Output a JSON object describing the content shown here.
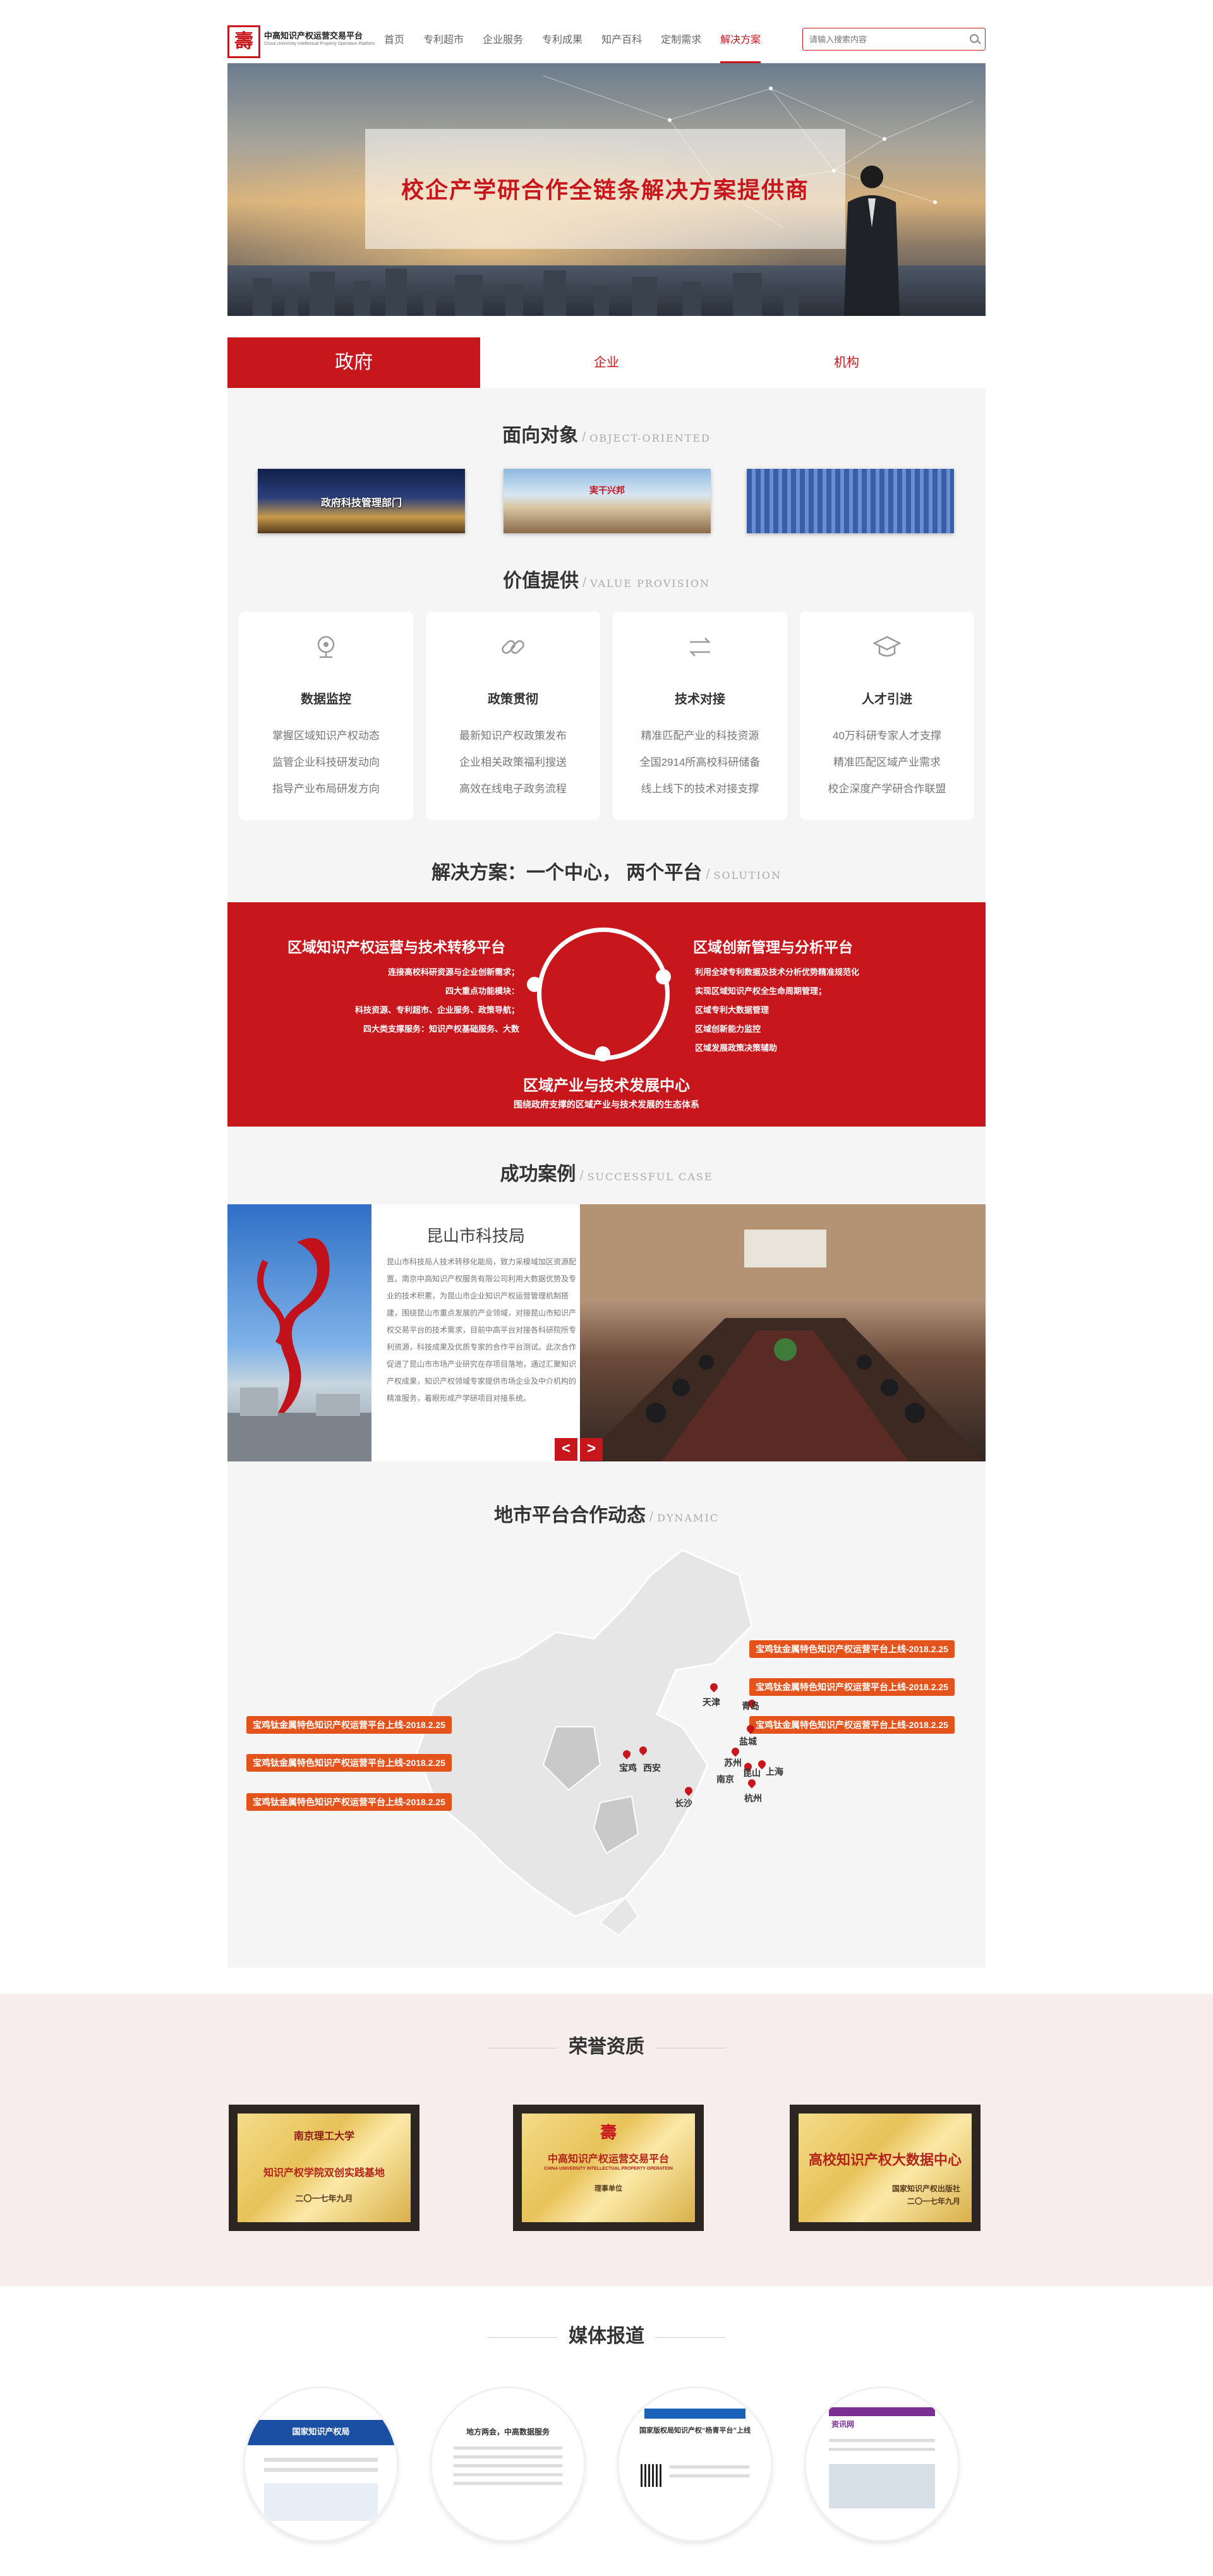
{
  "header": {
    "logo_glyph": "壽",
    "logo_text": "中高知识产权运营交易平台",
    "logo_subtext": "China University Intellectual Property Operation Platform",
    "nav": [
      {
        "label": "首页",
        "active": false
      },
      {
        "label": "专利超市",
        "active": false
      },
      {
        "label": "企业服务",
        "active": false
      },
      {
        "label": "专利成果",
        "active": false
      },
      {
        "label": "知产百科",
        "active": false
      },
      {
        "label": "定制需求",
        "active": false
      },
      {
        "label": "解决方案",
        "active": true
      }
    ],
    "search_placeholder": "请输入搜索内容"
  },
  "hero": {
    "title": "校企产学研合作全链条解决方案提供商"
  },
  "tabs": [
    {
      "label": "政府",
      "active": true
    },
    {
      "label": "企业",
      "active": false
    },
    {
      "label": "机构",
      "active": false
    }
  ],
  "object_section": {
    "title": "面向对象",
    "en": "Object-oriented",
    "targets": [
      {
        "label": "政府科技管理部门"
      },
      {
        "label": "実干兴邦"
      },
      {
        "label": ""
      }
    ]
  },
  "value_section": {
    "title": "价值提供",
    "en": "Value provision",
    "cards": [
      {
        "icon": "monitor-icon",
        "title": "数据监控",
        "lines": [
          "掌握区域知识产权动态",
          "监管企业科技研发动向",
          "指导产业布局研发方向"
        ]
      },
      {
        "icon": "link-icon",
        "title": "政策贯彻",
        "lines": [
          "最新知识产权政策发布",
          "企业相关政策福利搜送",
          "高效在线电子政务流程"
        ]
      },
      {
        "icon": "exchange-icon",
        "title": "技术对接",
        "lines": [
          "精准匹配产业的科技资源",
          "全国2914所高校科研储备",
          "线上线下的技术对接支撑"
        ]
      },
      {
        "icon": "graduation-cap-icon",
        "title": "人才引进",
        "lines": [
          "40万科研专家人才支撑",
          "精准匹配区域产业需求",
          "校企深度产学研合作联盟"
        ]
      }
    ]
  },
  "solution": {
    "title": "解决方案：一个中心， 两个平台",
    "en": "Solution",
    "left_title": "区域知识产权运营与技术转移平台",
    "left_lines": [
      "连接高校科研资源与企业创新需求；",
      "四大重点功能模块：",
      "科技资源、专利超市、企业服务、政策导航；",
      "四大类支撑服务：知识产权基础服务、大数"
    ],
    "right_title": "区域创新管理与分析平台",
    "right_lines": [
      "利用全球专利数据及技术分析优势精准规范化",
      "实现区域知识产权全生命周期管理；",
      "区域专利大数据管理",
      "区域创新能力监控",
      "区域发展政策决策辅助"
    ],
    "bottom_title": "区域产业与技术发展中心",
    "bottom_sub": "围绕政府支撑的区域产业与技术发展的生态体系"
  },
  "case_section": {
    "title": "成功案例",
    "en": "Successful case",
    "case_title": "昆山市科技局",
    "case_body": "昆山市科技局人技术转移化能局，致力采模域加区资源配置。南京中高知识产权服务有限公司利用大数据优势及专业的技术积累，为昆山市企业知识产权运营管理机制搭建，围绕昆山市重点发展的产业领域，对接昆山市知识产权交易平台的技术需求，目前中高平台对接各科研院所专利资源，科技成果及优质专家的合作平台测试。此次合作促进了昆山市市场产业研究在存项目落地，通过汇聚知识产权成果，知识产权领域专家提供市场企业及中介机构的精准服务，着眼形成产学研项目对接系统。",
    "prev_label": "<",
    "next_label": ">"
  },
  "dynamic_section": {
    "title": "地市平台合作动态",
    "en": "Dynamic",
    "left_labels": [
      "宝鸡钛金属特色知识产权运营平台上线-2018.2.25",
      "宝鸡钛金属特色知识产权运营平台上线-2018.2.25",
      "宝鸡钛金属特色知识产权运营平台上线-2018.2.25"
    ],
    "right_labels": [
      "宝鸡钛金属特色知识产权运营平台上线-2018.2.25",
      "宝鸡钛金属特色知识产权运营平台上线-2018.2.25",
      "宝鸡钛金属特色知识产权运营平台上线-2018.2.25"
    ],
    "cities": [
      "天津",
      "青岛",
      "盐城",
      "宝鸡",
      "西安",
      "苏州",
      "南京",
      "昆山",
      "上海",
      "杭州",
      "长沙"
    ]
  },
  "honors": {
    "title": "荣誉资质",
    "items": [
      {
        "lines": [
          "南京理工大学",
          "知识产权学院双创实践基地",
          "二〇一七年九月"
        ]
      },
      {
        "lines": [
          "中高知识产权运营交易平台",
          "CHINA UNIVERSITY INTELLECTUAL PROPERTY OPERATION",
          "理事单位"
        ]
      },
      {
        "lines": [
          "高校知识产权大数据中心",
          "国家知识产权出版社",
          "二〇一七年九月"
        ]
      }
    ]
  },
  "media": {
    "title": "媒体报道",
    "items": [
      {
        "name": "国家知识产权局"
      },
      {
        "name": "地方两会，中高数据服务"
      },
      {
        "name": "国家版权局知识产权“杨青平台”上线"
      },
      {
        "name": "资讯网"
      }
    ]
  },
  "colors": {
    "brand_red": "#c8161d",
    "label_orange": "#e5531d",
    "gray_bg": "#f5f5f5",
    "honor_bg": "#f8eded"
  }
}
